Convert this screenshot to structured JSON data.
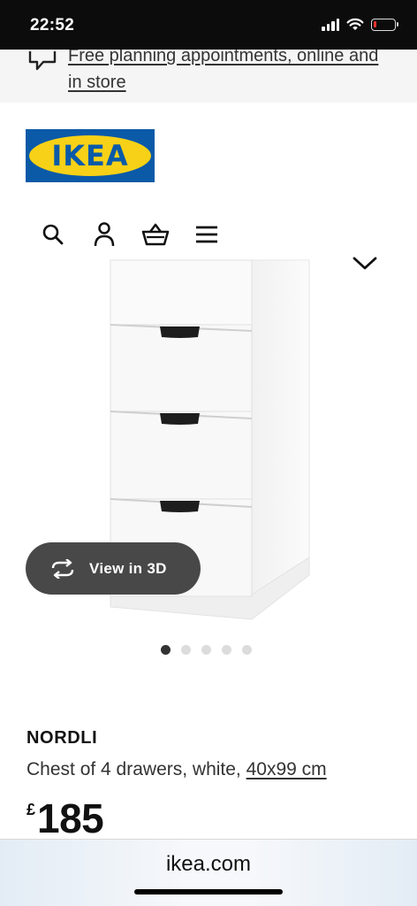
{
  "status_bar": {
    "time": "22:52",
    "battery_level": 0.15,
    "battery_color": "#e8322e"
  },
  "banner": {
    "link_text": "Free planning appointments, online and in store",
    "icon": "chat-bubble-icon"
  },
  "logo": {
    "text": "IKEA",
    "colors": {
      "blue": "#0a5aa8",
      "yellow": "#f7d117"
    }
  },
  "toolbar": {
    "icons": [
      "search-icon",
      "account-icon",
      "basket-icon",
      "menu-icon"
    ]
  },
  "gallery": {
    "view_3d_label": "View in 3D",
    "image_count": 5,
    "active_index": 0
  },
  "product": {
    "name": "NORDLI",
    "description": "Chest of 4 drawers, white, ",
    "size": "40x99 cm",
    "currency": "£",
    "price": "185"
  },
  "browser": {
    "address": "ikea.com"
  }
}
